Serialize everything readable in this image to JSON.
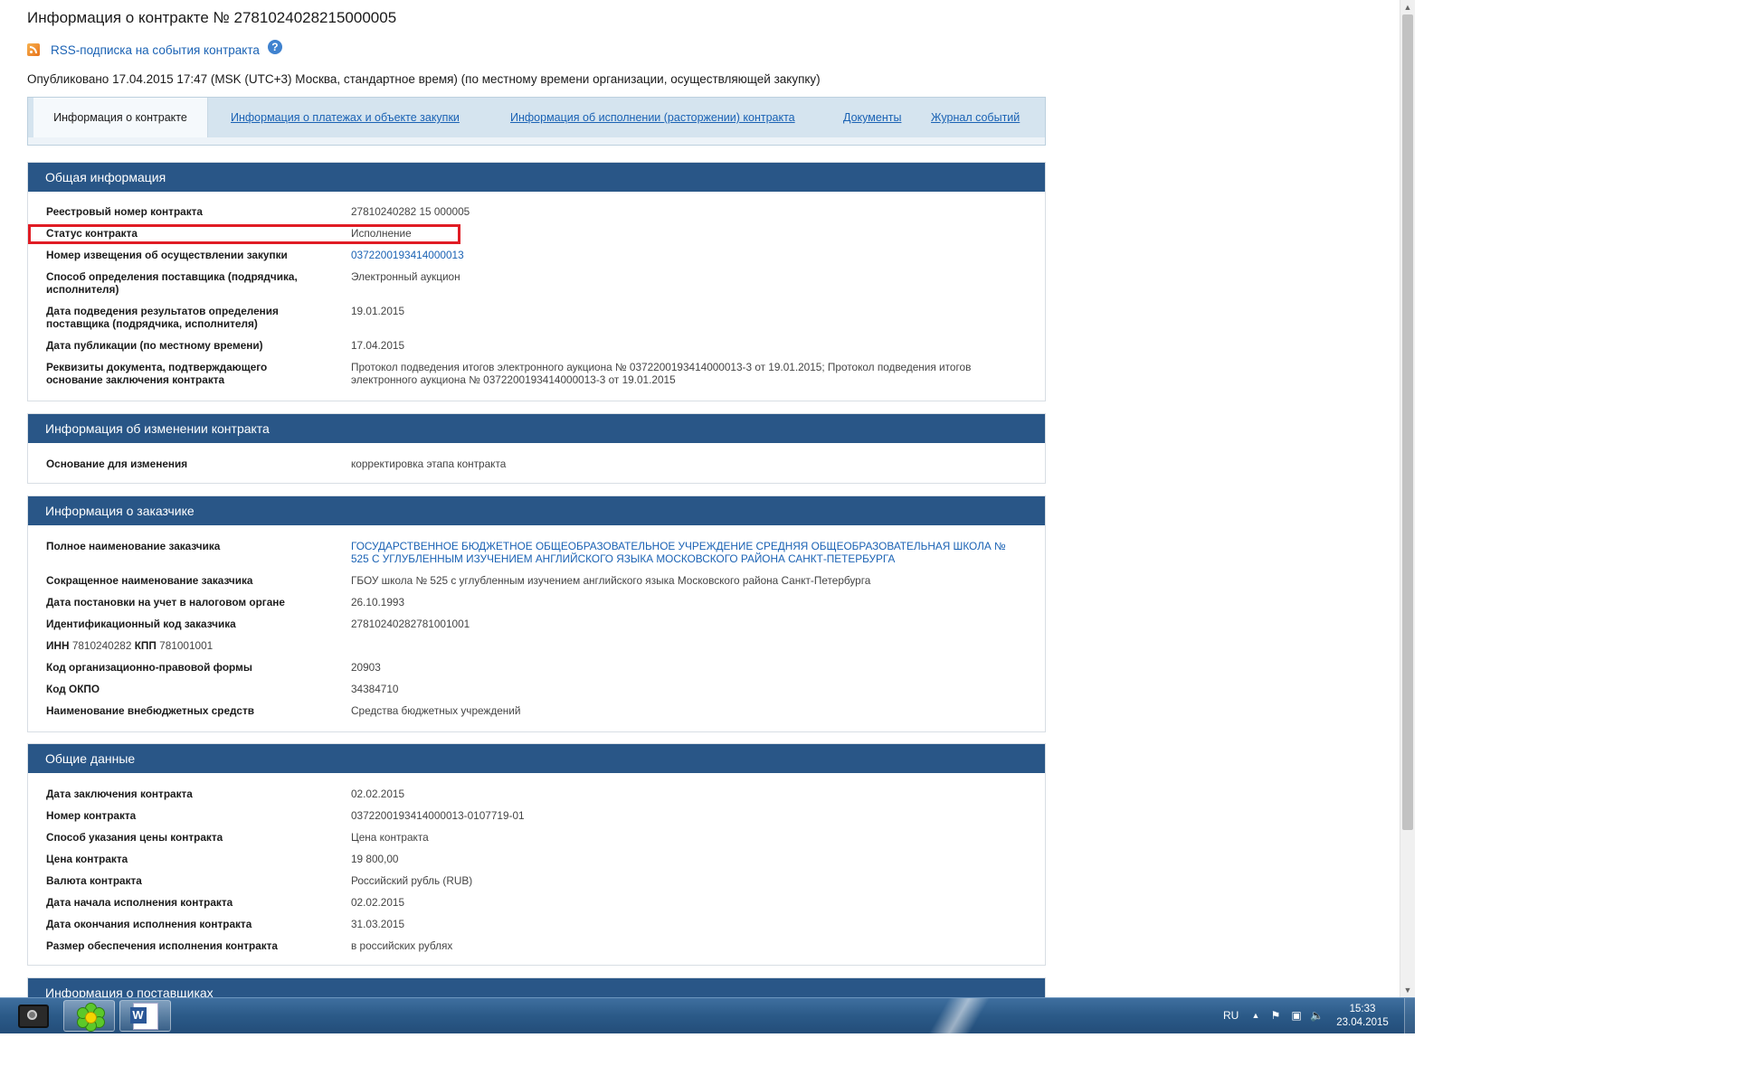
{
  "page": {
    "title": "Информация о контракте № 2781024028215000005",
    "rss_link": "RSS-подписка на события контракта",
    "help": "?",
    "published": "Опубликовано 17.04.2015 17:47 (MSK (UTC+3) Москва, стандартное время) (по местному времени организации, осуществляющей закупку)"
  },
  "tabs": [
    {
      "label": "Информация о контракте",
      "active": true
    },
    {
      "label": "Информация о платежах и объекте закупки"
    },
    {
      "label": "Информация об исполнении (расторжении) контракта"
    },
    {
      "label": "Документы"
    },
    {
      "label": "Журнал событий"
    }
  ],
  "sections": {
    "general": {
      "title": "Общая информация",
      "rows": [
        {
          "label": "Реестровый номер контракта",
          "value": "27810240282 15 000005"
        },
        {
          "label": "Статус контракта",
          "value": "Исполнение"
        },
        {
          "label": "Номер извещения об осуществлении закупки",
          "value": "0372200193414000013"
        },
        {
          "label": "Способ определения поставщика (подрядчика, исполнителя)",
          "value": "Электронный аукцион"
        },
        {
          "label": "Дата подведения результатов определения поставщика (подрядчика, исполнителя)",
          "value": "19.01.2015"
        },
        {
          "label": "Дата публикации (по местному времени)",
          "value": "17.04.2015"
        },
        {
          "label": "Реквизиты документа, подтверждающего основание заключения контракта",
          "value": "Протокол подведения итогов электронного аукциона № 0372200193414000013-3 от 19.01.2015; Протокол подведения итогов электронного аукциона № 0372200193414000013-3 от 19.01.2015"
        }
      ]
    },
    "changes": {
      "title": "Информация об изменении контракта",
      "rows": [
        {
          "label": "Основание для изменения",
          "value": "корректировка этапа контракта"
        }
      ]
    },
    "customer": {
      "title": "Информация о заказчике",
      "rows": [
        {
          "label": "Полное наименование заказчика",
          "value": "ГОСУДАРСТВЕННОЕ БЮДЖЕТНОЕ ОБЩЕОБРАЗОВАТЕЛЬНОЕ УЧРЕЖДЕНИЕ СРЕДНЯЯ ОБЩЕОБРАЗОВАТЕЛЬНАЯ ШКОЛА № 525 С УГЛУБЛЕННЫМ ИЗУЧЕНИЕМ АНГЛИЙСКОГО ЯЗЫКА МОСКОВСКОГО РАЙОНА САНКТ-ПЕТЕРБУРГА"
        },
        {
          "label": "Сокращенное наименование заказчика",
          "value": "ГБОУ школа № 525 с углубленным изучением английского языка Московского района Санкт-Петербурга"
        },
        {
          "label": "Дата постановки на учет в налоговом органе",
          "value": "26.10.1993"
        },
        {
          "label": "Идентификационный код заказчика",
          "value": "27810240282781001001"
        },
        {
          "inn_label": "ИНН",
          "inn_value": "7810240282",
          "kpp_label": "КПП",
          "kpp_value": "781001001"
        },
        {
          "label": "Код организационно-правовой формы",
          "value": "20903"
        },
        {
          "label": "Код ОКПО",
          "value": "34384710"
        },
        {
          "label": "Наименование внебюджетных средств",
          "value": "Средства бюджетных учреждений"
        }
      ]
    },
    "common": {
      "title": "Общие данные",
      "rows": [
        {
          "label": "Дата заключения контракта",
          "value": "02.02.2015"
        },
        {
          "label": "Номер контракта",
          "value": "0372200193414000013-0107719-01"
        },
        {
          "label": "Способ указания цены контракта",
          "value": "Цена контракта"
        },
        {
          "label": "Цена контракта",
          "value": "19 800,00"
        },
        {
          "label": "Валюта контракта",
          "value": "Российский рубль (RUB)"
        },
        {
          "label": "Дата начала исполнения контракта",
          "value": "02.02.2015"
        },
        {
          "label": "Дата окончания исполнения контракта",
          "value": "31.03.2015"
        },
        {
          "label": "Размер обеспечения исполнения контракта",
          "value": "в российских рублях"
        }
      ]
    },
    "suppliers": {
      "title": "Информация о поставщиках"
    }
  },
  "taskbar": {
    "language": "RU",
    "time": "15:33",
    "date": "23.04.2015",
    "apps": [
      "camera-app-icon",
      "icq-flower-icon",
      "word-icon"
    ]
  },
  "colors": {
    "section_header": "#295687",
    "link": "#1a62b4",
    "highlight_box": "#e01c24",
    "tabs_bg": "#d5e4ef"
  }
}
